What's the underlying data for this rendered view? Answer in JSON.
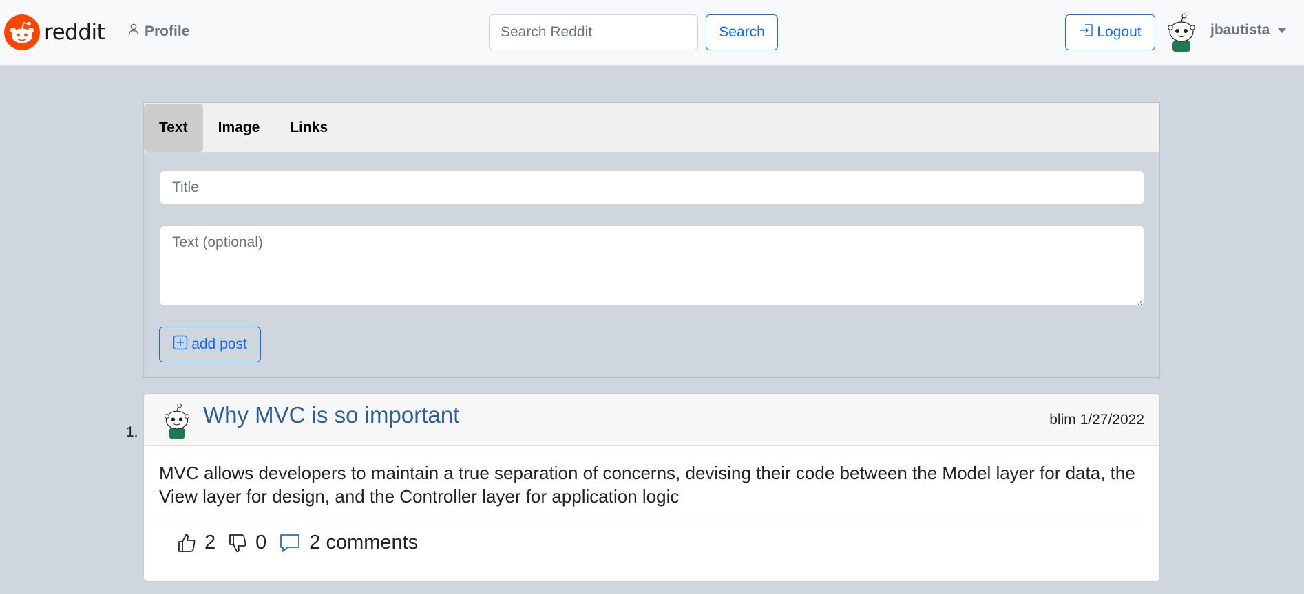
{
  "navbar": {
    "brand_text": "reddit",
    "profile_label": "Profile",
    "search": {
      "placeholder": "Search Reddit",
      "value": "",
      "button_label": "Search"
    },
    "logout_label": "Logout",
    "username": "jbautista"
  },
  "composer": {
    "tabs": [
      {
        "label": "Text",
        "active": true
      },
      {
        "label": "Image",
        "active": false
      },
      {
        "label": "Links",
        "active": false
      }
    ],
    "title_placeholder": "Title",
    "text_placeholder": "Text (optional)",
    "add_post_label": "add post"
  },
  "posts": [
    {
      "number": "1.",
      "title": "Why MVC is so important",
      "author": "blim",
      "date": "1/27/2022",
      "meta": "blim 1/27/2022",
      "body": "MVC allows developers to maintain a true separation of concerns, devising their code between the Model layer for data, the View layer for design, and the Controller layer for application logic",
      "upvotes": "2",
      "downvotes": "0",
      "comments": "2 comments"
    }
  ],
  "colors": {
    "brand_orange": "#ff4500",
    "primary_blue": "#0d6efd",
    "post_title_blue": "#2c5f9c",
    "page_background": "#cfd6de"
  }
}
